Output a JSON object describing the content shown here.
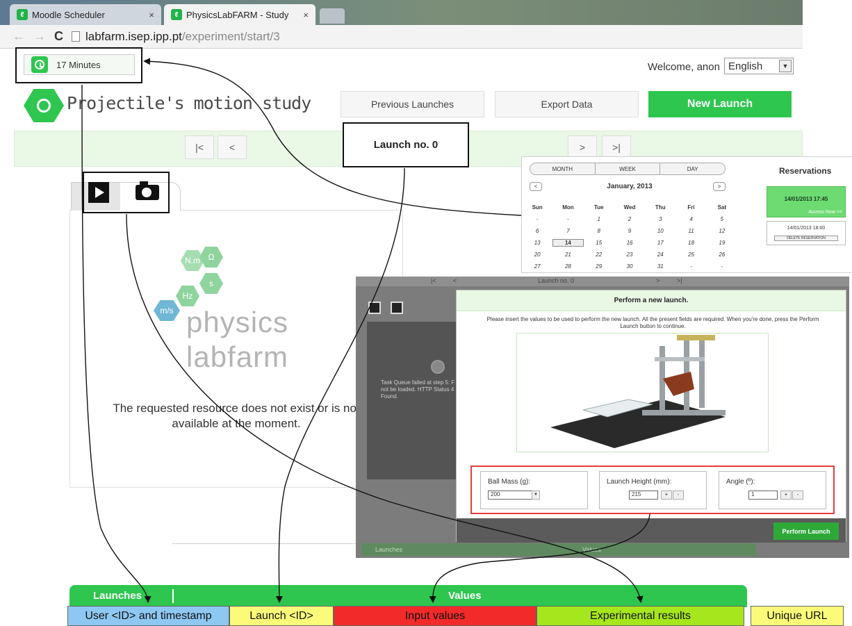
{
  "browser": {
    "tabs": [
      {
        "title": "Moodle Scheduler",
        "close": "×"
      },
      {
        "title": "PhysicsLabFARM - Study",
        "close": "×"
      }
    ],
    "url_host": "labfarm.isep.ipp.pt",
    "url_path": "/experiment/start/3"
  },
  "header": {
    "timer": "17 Minutes",
    "welcome": "Welcome, anon",
    "language": "English",
    "title": "Projectile's motion study",
    "buttons": {
      "previous": "Previous Launches",
      "export": "Export Data",
      "new_launch": "New Launch"
    }
  },
  "launch_nav": {
    "first": "|<",
    "prev": "<",
    "label": "Launch no. 0",
    "next": ">",
    "last": ">|"
  },
  "logo": {
    "hexes": [
      "N.m",
      "Ω",
      "s",
      "Hz",
      "m/s"
    ],
    "word1": "physics",
    "word2": "labfarm"
  },
  "content": {
    "message": "The requested resource does not exist or is not available at the moment."
  },
  "calendar": {
    "views": [
      "MONTH",
      "WEEK",
      "DAY"
    ],
    "prev": "<",
    "next": ">",
    "month": "January, 2013",
    "weekdays": [
      "Sun",
      "Mon",
      "Tue",
      "Wed",
      "Thu",
      "Fri",
      "Sat"
    ],
    "weeks": [
      [
        "-",
        "-",
        "1",
        "2",
        "3",
        "4",
        "5"
      ],
      [
        "6",
        "7",
        "8",
        "9",
        "10",
        "11",
        "12"
      ],
      [
        "13",
        "14",
        "15",
        "16",
        "17",
        "18",
        "19"
      ],
      [
        "20",
        "21",
        "22",
        "23",
        "24",
        "25",
        "26"
      ],
      [
        "27",
        "28",
        "29",
        "30",
        "31",
        "-",
        "-"
      ]
    ],
    "today": "14",
    "reservations_title": "Reservations",
    "reservation_active": "14/01/2013 17:45",
    "access_now": "Access Now >>",
    "reservation_next": "14/01/2013 18:00",
    "delete_label": "DELETE RESERVATION"
  },
  "launch_modal": {
    "bg_launch_label": "Launch no. 0",
    "bg_first": "|<",
    "bg_prev": "<",
    "bg_next": ">",
    "bg_last": ">|",
    "error_text": "Task Queue failed at step 5: F not be loaded. HTTP Status 4 Found.",
    "title": "Perform a new launch.",
    "description": "Please insert the values to be used to perform the new launch. All the present fields are required. When you're done, press the Perform Launch button to continue.",
    "ball_mass_label": "Ball Mass (g):",
    "ball_mass_value": "200",
    "launch_height_label": "Launch Height (mm):",
    "launch_height_value": "215",
    "angle_label": "Angle (º):",
    "angle_value": "1",
    "plus": "+",
    "minus": "-",
    "perform_button": "Perform Launch",
    "bg_bottom_launches": "Launches",
    "bg_bottom_values": "Values"
  },
  "bottom_bar": {
    "launches": "Launches",
    "values": "Values"
  },
  "annotations": {
    "user": "User <ID> and timestamp",
    "launch": "Launch <ID>",
    "input": "Input values",
    "results": "Experimental results",
    "url": "Unique URL"
  },
  "colors": {
    "accent_green": "#2ec64f",
    "annotation_blue": "#8ec8f2",
    "annotation_yellow": "#fbfb79",
    "annotation_red": "#f22a2a",
    "annotation_lime": "#a6e61c"
  }
}
